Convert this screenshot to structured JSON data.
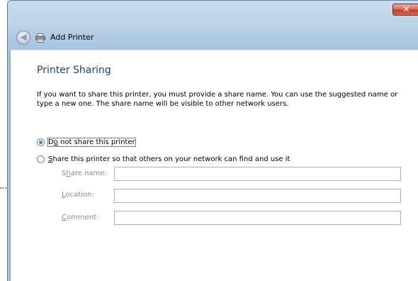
{
  "window": {
    "title": "Add Printer",
    "close_glyph": "✕"
  },
  "page": {
    "heading": "Printer Sharing",
    "description": "If you want to share this printer, you must provide a share name. You can use the suggested name or type a new one. The share name will be visible to other network users."
  },
  "options": [
    {
      "pre": "D",
      "mnemonic": "o",
      "post": " not share this printer",
      "checked": true
    },
    {
      "pre": "",
      "mnemonic": "S",
      "post": "hare this printer so that others on your network can find and use it",
      "checked": false
    }
  ],
  "fields": [
    {
      "pre": "S",
      "mnemonic": "h",
      "post": "are name:",
      "value": ""
    },
    {
      "pre": "",
      "mnemonic": "L",
      "post": "ocation:",
      "value": ""
    },
    {
      "pre": "",
      "mnemonic": "C",
      "post": "omment:",
      "value": ""
    }
  ],
  "icons": {
    "back": "back-arrow-icon",
    "printer": "printer-icon",
    "close": "close-icon"
  }
}
